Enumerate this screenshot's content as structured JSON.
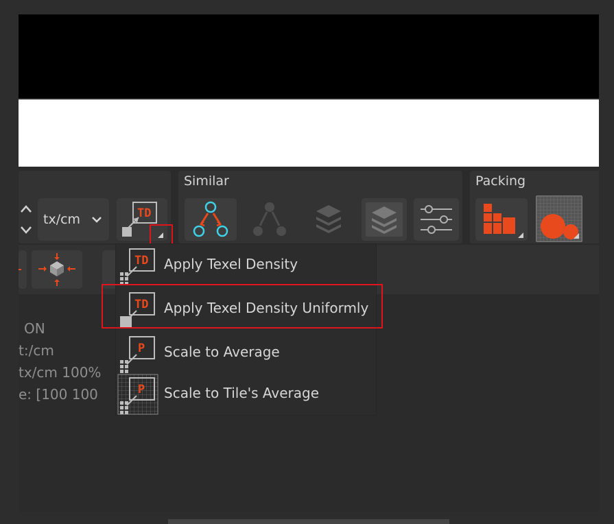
{
  "toolbar": {
    "unit_select": {
      "value": "tx/cm"
    },
    "similar_group": {
      "title": "Similar"
    },
    "packing_group": {
      "title": "Packing"
    }
  },
  "info_lines": [
    " ON",
    "t:/cm",
    "tx/cm  100%",
    "e: [100   100"
  ],
  "dropdown": {
    "items": [
      {
        "label": "Apply Texel Density",
        "icon": "texel-density-icon",
        "badge": "TD"
      },
      {
        "label": "Apply Texel Density Uniformly",
        "icon": "texel-density-uniform-icon",
        "badge": "TD",
        "highlighted": true
      },
      {
        "label": "Scale to Average",
        "icon": "scale-average-icon",
        "badge": "P"
      },
      {
        "label": "Scale to Tile's Average",
        "icon": "scale-tile-average-icon",
        "badge": "P"
      }
    ]
  },
  "colors": {
    "accent_orange": "#e8491d",
    "accent_cyan": "#3fd1e6",
    "highlight_red": "#e0141b"
  }
}
